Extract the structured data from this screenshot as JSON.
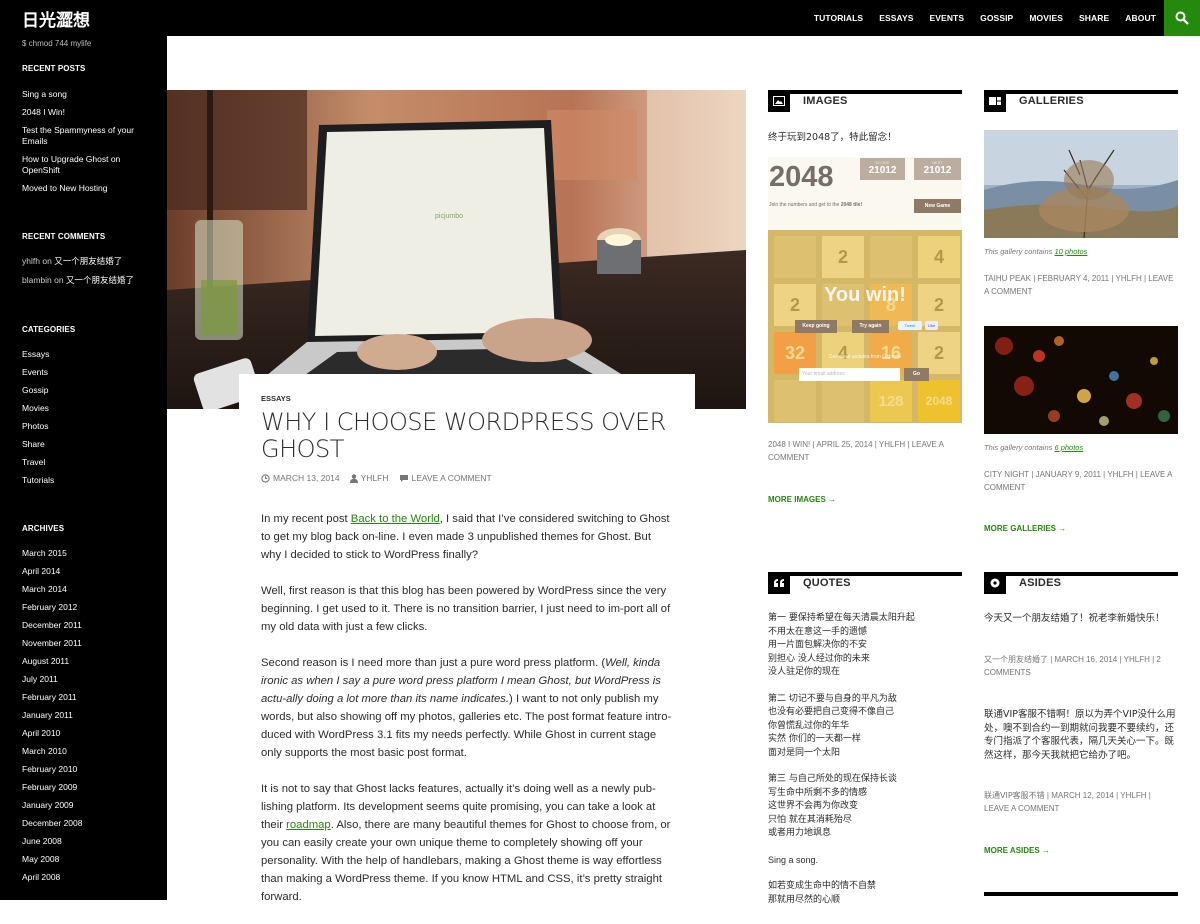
{
  "site": {
    "title": "日光澀想",
    "tagline": "$ chmod 744 mylife"
  },
  "nav": [
    "TUTORIALS",
    "ESSAYS",
    "EVENTS",
    "GOSSIP",
    "MOVIES",
    "SHARE",
    "ABOUT"
  ],
  "sidebar": {
    "recent_posts": {
      "heading": "RECENT POSTS",
      "items": [
        "Sing a song",
        "2048 I Win!",
        "Test the Spammyness of your Emails",
        "How to Upgrade Ghost on OpenShift",
        "Moved to New Hosting"
      ]
    },
    "recent_comments": {
      "heading": "RECENT COMMENTS",
      "items": [
        {
          "author": "yhlfh",
          "on": "on",
          "post": "又一个朋友结婚了"
        },
        {
          "author": "blambin",
          "on": "on",
          "post": "又一个朋友结婚了"
        }
      ]
    },
    "categories": {
      "heading": "CATEGORIES",
      "items": [
        "Essays",
        "Events",
        "Gossip",
        "Movies",
        "Photos",
        "Share",
        "Travel",
        "Tutorials"
      ]
    },
    "archives": {
      "heading": "ARCHIVES",
      "items": [
        "March 2015",
        "April 2014",
        "March 2014",
        "February 2012",
        "December 2011",
        "November 2011",
        "August 2011",
        "July 2011",
        "February 2011",
        "January 2011",
        "April 2010",
        "March 2010",
        "February 2010",
        "February 2009",
        "January 2009",
        "December 2008",
        "June 2008",
        "May 2008",
        "April 2008"
      ]
    }
  },
  "post": {
    "category": "ESSAYS",
    "title": "WHY I CHOOSE WORDPRESS OVER GHOST",
    "date": "MARCH 13, 2014",
    "author": "YHLFH",
    "comment": "LEAVE A COMMENT",
    "image_text": "picjumbo",
    "p1_a": "In my recent post ",
    "p1_link": "Back to the World",
    "p1_b": ", I said that I’ve considered switching to Ghost to get my blog back on-line. I even made 3 unpublished themes for Ghost. But why I decided to stick to WordPress finally?",
    "p2": "Well, first reason is that this blog has been powered by WordPress since the very beginning. I get used to it. There is no transition barrier, I just need to im-port all of my old data with just a few clicks.",
    "p3_a": "Second reason is I need more than just a pure word press platform. (",
    "p3_em": "Well, kinda ironic as when I say a pure word press platform I mean Ghost, but WordPress is actu-ally doing a lot more than its name indicates.",
    "p3_b": ") I want to not only publish my words, but also showing off my photos, galleries etc. The post format feature intro-duced with WordPress 3.1 fits my needs perfectly. While Ghost in current stage  only supports the most basic post format.",
    "p4_a": "It is not to say that Ghost lacks features, actually it’s doing well as a newly pub-lishing platform. Its development seems quite promising, you can take a look at their ",
    "p4_link": "roadmap",
    "p4_b": ". Also, there are many beautiful themes for Ghost to choose from, or you can easily create your own unique theme to completely showing off your personality. With the help of handlebars, making a Ghost theme is way effortless than making a WordPress theme. If you know HTML and CSS, it’s pretty straight forward."
  },
  "images_widget": {
    "title": "IMAGES",
    "text": "终于玩到2048了，特此留念！",
    "game": {
      "logo": "2048",
      "score_label": "SCORE",
      "score": "21012",
      "best_label": "BEST",
      "best": "21012",
      "intro_a": "Join the numbers and get to the ",
      "intro_b": "2048 tile!",
      "new_game": "New Game",
      "win": "You win!",
      "keep": "Keep going",
      "try": "Try again",
      "tweet": "Tweet",
      "like": "Like",
      "updates": "Get email updates from Gabriele",
      "email_placeholder": "Your email address",
      "go": "Go",
      "tiles": [
        "",
        "2",
        "",
        "4",
        "2",
        "",
        "8",
        "2",
        "32",
        "4",
        "16",
        "2",
        "",
        "",
        "128",
        "2048"
      ]
    },
    "meta_a": "2048 I WIN!",
    "meta_b": "APRIL 25, 2014",
    "meta_c": "YHLFH",
    "meta_d": "LEAVE A COMMENT",
    "more": "MORE IMAGES →"
  },
  "galleries_widget": {
    "title": "GALLERIES",
    "g1_caption": "This gallery contains ",
    "g1_link": "10 photos",
    "g1_meta_a": "TAIHU PEAK",
    "g1_meta_b": "FEBRUARY 4, 2011",
    "g1_meta_c": "YHLFH",
    "g1_meta_d": "LEAVE A COMMENT",
    "g2_caption": "This gallery contains ",
    "g2_link": "6 photos",
    "g2_meta_a": "CITY NIGHT",
    "g2_meta_b": "JANUARY 9, 2011",
    "g2_meta_c": "YHLFH",
    "g2_meta_d": "LEAVE A COMMENT",
    "more": "MORE GALLERIES →"
  },
  "quotes_widget": {
    "title": "QUOTES",
    "stanza1": [
      "第一 要保持希望在每天清晨太阳升起",
      "不用太在意这一手的遗憾",
      "用一片面包解决你的不安",
      "别担心 没人经过你的未来",
      "没人驻足你的现在"
    ],
    "stanza2": [
      "第二 切记不要与自身的平凡为敌",
      "也没有必要把自己变得不像自己",
      "你曾慌乱过你的年华",
      "实然 你们的一天都一样",
      "面对是同一个太阳"
    ],
    "stanza3": [
      "第三 与自己所处的现在保持长谈",
      "写生命中所剩不多的情感",
      "这世界不会再为你改变",
      "只怕 就在其消耗殆尽",
      "或者用力地飒息"
    ],
    "sing": "Sing a song.",
    "stanza4": [
      "如若变成生命中的情不自禁",
      "那就用尽然的心顺"
    ]
  },
  "asides_widget": {
    "title": "ASIDES",
    "a1": "今天又一个朋友结婚了！祝老李新婚快乐！",
    "a1_meta_a": "又一个朋友结婚了",
    "a1_meta_b": "MARCH 16, 2014",
    "a1_meta_c": "YHLFH",
    "a1_meta_d": "2 COMMENTS",
    "a2": "联通VIP客服不错啊！原以为弄个VIP没什么用处，噢不到合约一到期就问我要不要续约，还专门指派了个客服代表，隔几天关心一下。既然这样，那今天我就把它给办了吧。",
    "a2_meta_a": "联通VIP客服不错",
    "a2_meta_b": "MARCH 12, 2014",
    "a2_meta_c": "YHLFH",
    "a2_meta_d": "LEAVE A COMMENT",
    "more": "MORE ASIDES →"
  },
  "colors": {
    "accent": "#24890d",
    "dark": "#000000",
    "text": "#2b2b2b",
    "meta": "#767676"
  }
}
